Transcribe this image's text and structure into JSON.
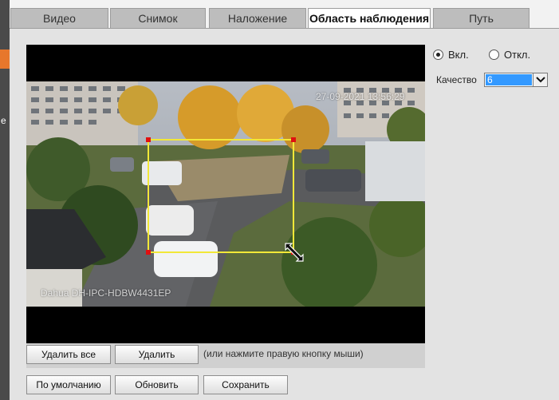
{
  "tabs": [
    {
      "label": "Видео"
    },
    {
      "label": "Снимок"
    },
    {
      "label": "Наложение"
    },
    {
      "label": "Область наблюдения"
    },
    {
      "label": "Путь"
    }
  ],
  "active_tab": "Область наблюдения",
  "video": {
    "timestamp": "27-09-2021 13:56:29",
    "camera_label": "Dahua DH-IPC-HDBW4431EP"
  },
  "enable": {
    "on_label": "Вкл.",
    "off_label": "Откл.",
    "selected": "on"
  },
  "quality": {
    "label": "Качество",
    "value": "6"
  },
  "buttons": {
    "delete_all": "Удалить все",
    "delete": "Удалить",
    "hint": "(или нажмите правую кнопку мыши)",
    "default": "По умолчанию",
    "refresh": "Обновить",
    "save": "Сохранить"
  },
  "left_rail": {
    "glyph": "е"
  },
  "colors": {
    "roi_border": "#f2e838",
    "roi_handle": "#e01010",
    "active_tab_bg": "#ffffff",
    "inactive_tab_bg": "#bdbdbd",
    "select_highlight": "#3399ff",
    "rail_accent": "#e7772c"
  }
}
